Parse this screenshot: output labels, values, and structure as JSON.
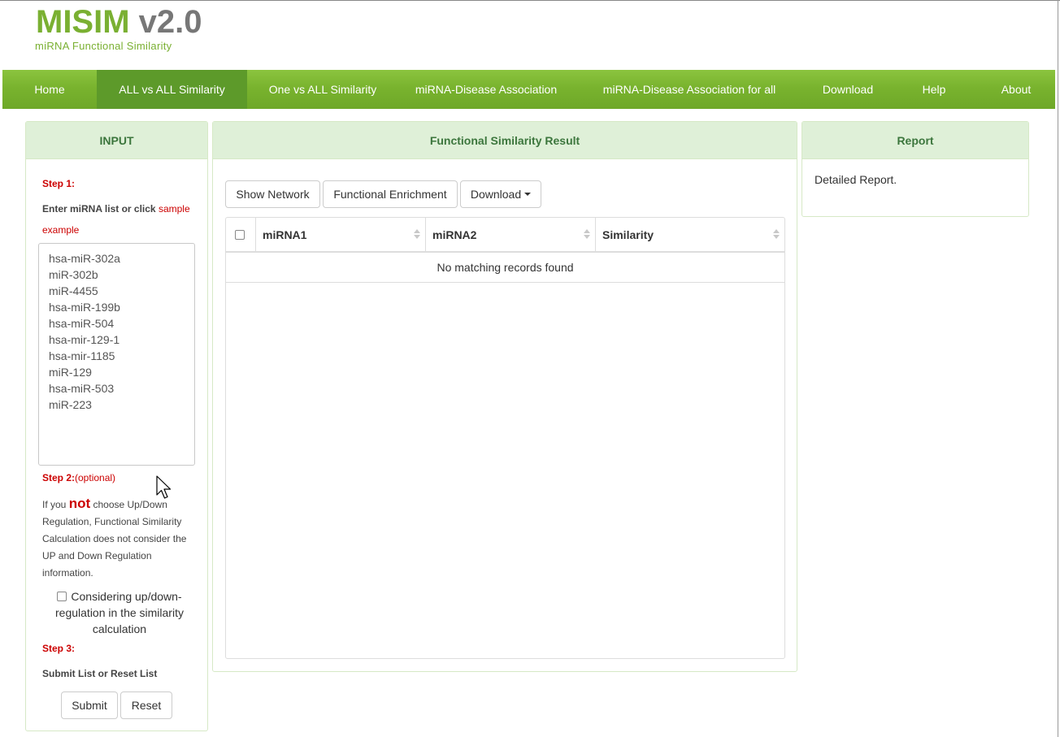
{
  "logo": {
    "name": "MISIM",
    "version": "v2.0",
    "subtitle": "miRNA Functional Similarity"
  },
  "nav": {
    "items": [
      {
        "label": "Home"
      },
      {
        "label": "ALL vs ALL Similarity",
        "active": true
      },
      {
        "label": "One vs ALL Similarity"
      },
      {
        "label": "miRNA-Disease Association"
      },
      {
        "label": "miRNA-Disease Association for all"
      },
      {
        "label": "Download"
      },
      {
        "label": "Help"
      },
      {
        "label": "About"
      }
    ]
  },
  "input_panel": {
    "title": "INPUT",
    "step1": "Step 1:",
    "enter_text": "Enter miRNA list or click",
    "sample_link": "sample",
    "example_link": "example",
    "mirna_list": [
      "hsa-miR-302a",
      "miR-302b",
      "miR-4455",
      "hsa-miR-199b",
      "hsa-miR-504",
      "hsa-mir-129-1",
      "hsa-mir-1185",
      "miR-129",
      "hsa-miR-503",
      "miR-223"
    ],
    "step2": "Step 2:",
    "step2_optional": "(optional)",
    "note_prefix": "If you",
    "note_not": "not",
    "note_suffix": "choose Up/Down Regulation, Functional Similarity Calculation does not consider the UP and Down Regulation information.",
    "checkbox_label": "Considering up/down-regulation in the similarity calculation",
    "step3": "Step 3:",
    "submit_text": "Submit List or Reset List",
    "submit_button": "Submit",
    "reset_button": "Reset"
  },
  "result_panel": {
    "title": "Functional Similarity Result",
    "buttons": {
      "show_network": "Show Network",
      "functional_enrichment": "Functional Enrichment",
      "download": "Download"
    },
    "columns": [
      "miRNA1",
      "miRNA2",
      "Similarity"
    ],
    "empty_message": "No matching records found"
  },
  "report_panel": {
    "title": "Report",
    "text": "Detailed Report."
  },
  "colors": {
    "brand_green": "#7ab032",
    "nav_active": "#5d9a2a",
    "panel_heading_bg": "#dff0d8",
    "panel_heading_text": "#3c763d",
    "step_red": "#cc0000"
  }
}
